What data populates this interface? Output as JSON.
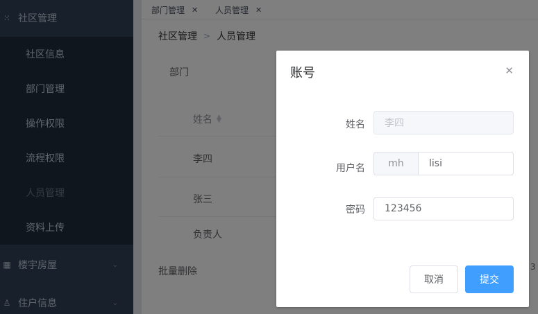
{
  "sidebar": {
    "groups": [
      {
        "label": "社区管理",
        "icon": "grid-icon"
      },
      {
        "label": "楼宇房屋",
        "icon": "building-icon"
      },
      {
        "label": "住户信息",
        "icon": "user-icon"
      }
    ],
    "items": [
      {
        "label": "社区信息"
      },
      {
        "label": "部门管理"
      },
      {
        "label": "操作权限"
      },
      {
        "label": "流程权限"
      },
      {
        "label": "人员管理"
      },
      {
        "label": "资料上传"
      }
    ],
    "active_item": "人员管理"
  },
  "tags": [
    {
      "label": "部门管理"
    },
    {
      "label": "人员管理"
    }
  ],
  "breadcrumb": {
    "parent": "社区管理",
    "separator": ">",
    "current": "人员管理"
  },
  "filter": {
    "label": "部门"
  },
  "table": {
    "column_name": "姓名",
    "rows": [
      {
        "name": "李四"
      },
      {
        "name": "张三"
      },
      {
        "name": "负责人"
      }
    ],
    "batch_delete": "批量删除",
    "edge_text": "3"
  },
  "dialog": {
    "title": "账号",
    "fields": {
      "name": {
        "label": "姓名",
        "value": "李四"
      },
      "username": {
        "label": "用户名",
        "prefix": "mh",
        "value": "lisi"
      },
      "password": {
        "label": "密码",
        "value": "123456"
      }
    },
    "buttons": {
      "cancel": "取消",
      "submit": "提交"
    }
  },
  "colors": {
    "sidebar_bg": "#304156",
    "primary": "#409eff"
  }
}
